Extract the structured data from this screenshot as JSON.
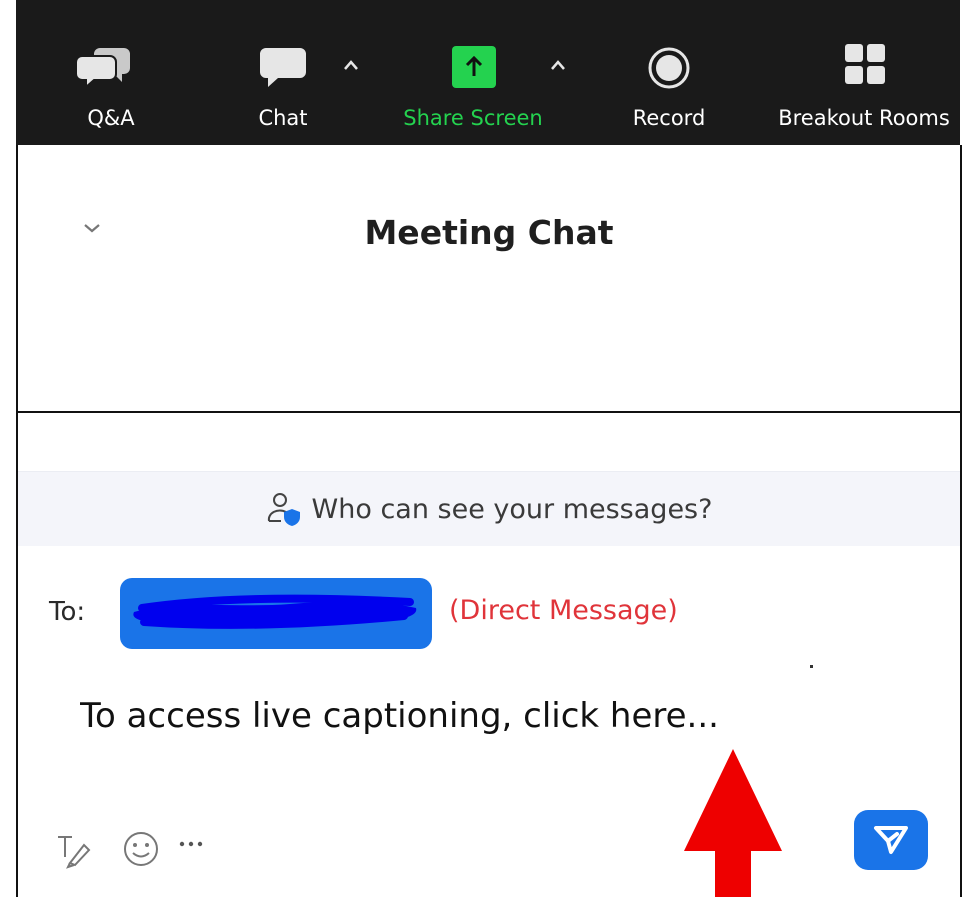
{
  "toolbar": {
    "qa_label": "Q&A",
    "chat_label": "Chat",
    "share_label": "Share Screen",
    "record_label": "Record",
    "breakout_label": "Breakout Rooms"
  },
  "chat": {
    "title": "Meeting Chat",
    "visibility_notice": "Who can see your messages?",
    "to_label": "To:",
    "recipient_name": "",
    "direct_message_label": "(Direct Message)",
    "message_text": "To access live captioning, click here..."
  },
  "colors": {
    "toolbar_bg": "#1a1a1a",
    "share_green": "#24d24f",
    "accent_blue": "#1a74e8",
    "direct_message_red": "#e0343a",
    "annotation_arrow": "#ee0000"
  },
  "icons": {
    "qa": "qa-icon",
    "chat": "chat-bubble-icon",
    "share": "share-screen-icon",
    "record": "record-icon",
    "breakout": "breakout-rooms-icon",
    "format": "text-format-icon",
    "emoji": "emoji-icon",
    "more": "more-icon",
    "send": "send-icon"
  }
}
